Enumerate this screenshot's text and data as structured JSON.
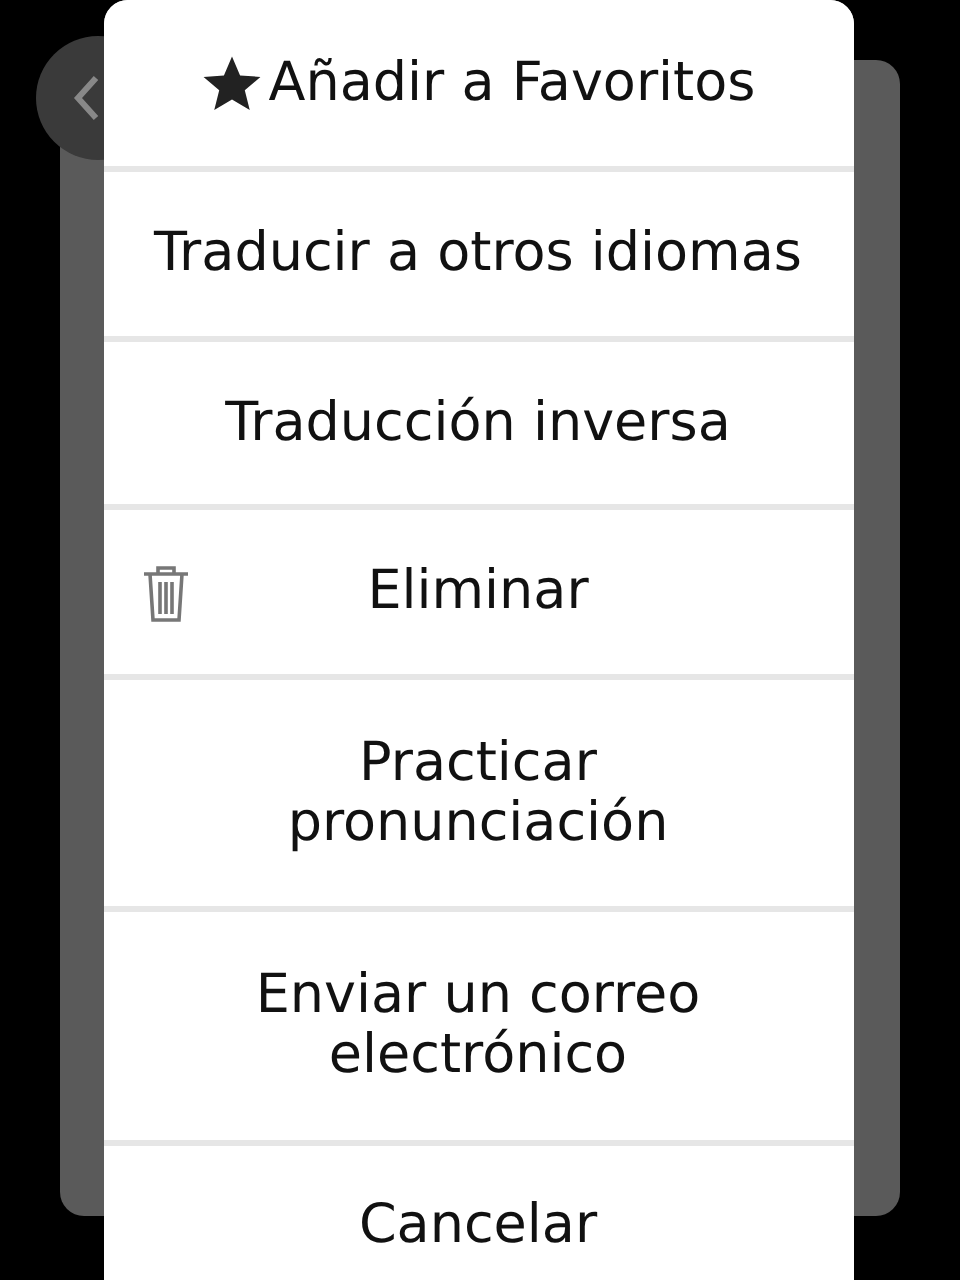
{
  "menu": {
    "items": [
      {
        "kind": "favorite",
        "label": "Añadir a Favoritos"
      },
      {
        "kind": "plain",
        "label": "Traducir a otros idiomas"
      },
      {
        "kind": "plain",
        "label": "Traducción inversa"
      },
      {
        "kind": "delete",
        "label": "Eliminar"
      },
      {
        "kind": "plain",
        "label": "Practicar pronunciación"
      },
      {
        "kind": "plain",
        "label": "Enviar un correo electrónico"
      },
      {
        "kind": "plain",
        "label": "Cancelar"
      }
    ]
  }
}
